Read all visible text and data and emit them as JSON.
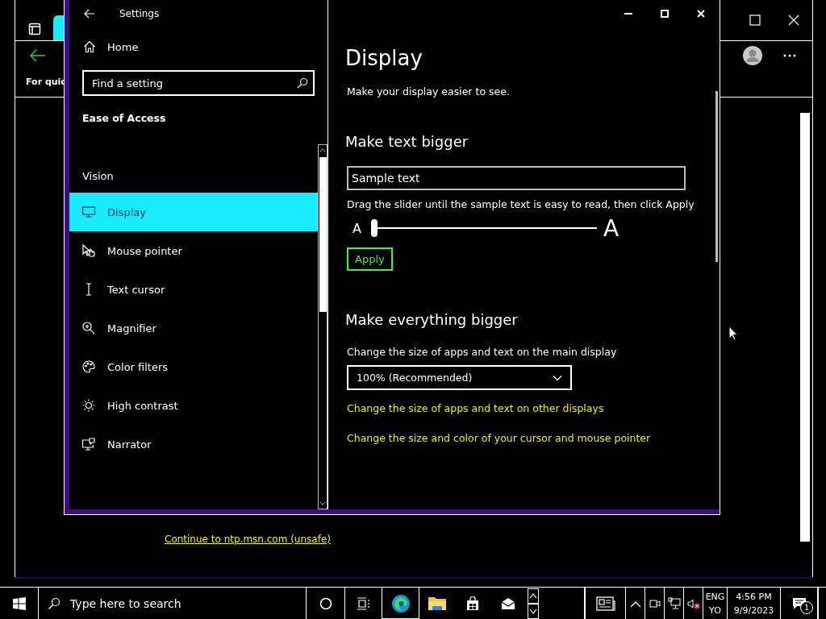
{
  "browser": {
    "notice": "For quic",
    "link": "Continue to ntp.msn.com (unsafe)"
  },
  "settings": {
    "title": "Settings",
    "home": "Home",
    "search": {
      "placeholder": "Find a setting"
    },
    "category": "Ease of Access",
    "group": "Vision",
    "items": [
      {
        "label": "Display",
        "selected": true
      },
      {
        "label": "Mouse pointer",
        "selected": false
      },
      {
        "label": "Text cursor",
        "selected": false
      },
      {
        "label": "Magnifier",
        "selected": false
      },
      {
        "label": "Color filters",
        "selected": false
      },
      {
        "label": "High contrast",
        "selected": false
      },
      {
        "label": "Narrator",
        "selected": false
      }
    ],
    "page": {
      "title": "Display",
      "subtitle": "Make your display easier to see.",
      "text_size": {
        "heading": "Make text bigger",
        "sample": "Sample text",
        "hint": "Drag the slider until the sample text is easy to read, then click Apply",
        "small_label": "A",
        "large_label": "A",
        "level": 0,
        "apply": "Apply"
      },
      "scale": {
        "heading": "Make everything bigger",
        "label": "Change the size of apps and text on the main display",
        "value": "100% (Recommended)",
        "links": [
          "Change the size of apps and text on other displays",
          "Change the size and color of your cursor and mouse pointer"
        ]
      }
    }
  },
  "taskbar": {
    "search": {
      "placeholder": "Type here to search"
    },
    "language": "ENG",
    "layout": "YO",
    "time": "4:56 PM",
    "date": "9/9/2023",
    "notifications": "1"
  }
}
